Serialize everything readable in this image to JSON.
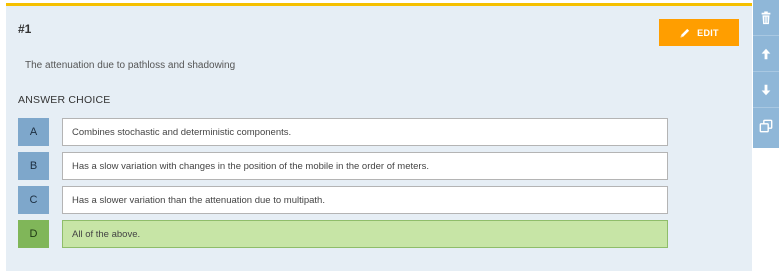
{
  "question": {
    "number": "#1",
    "text": "The attenuation due to pathloss and shadowing",
    "edit_label": "EDIT"
  },
  "answers": {
    "heading": "ANSWER CHOICE",
    "choices": [
      {
        "letter": "A",
        "text": "Combines stochastic and deterministic components.",
        "correct": false
      },
      {
        "letter": "B",
        "text": "Has a slow variation with changes in the position of the mobile in the order of meters.",
        "correct": false
      },
      {
        "letter": "C",
        "text": "Has a slower variation than the attenuation due to multipath.",
        "correct": false
      },
      {
        "letter": "D",
        "text": "All of the above.",
        "correct": true
      }
    ]
  },
  "side_tools": [
    "trash-icon",
    "arrow-up-icon",
    "arrow-down-icon",
    "duplicate-icon"
  ],
  "colors": {
    "card_background": "#e6eef5",
    "card_top_border": "#f5c000",
    "edit_button": "#ff9e00",
    "choice_letter": "#7ea7cb",
    "correct_letter": "#80b659",
    "correct_text": "#c7e5a6",
    "side_tools": "#8fb7d8"
  }
}
